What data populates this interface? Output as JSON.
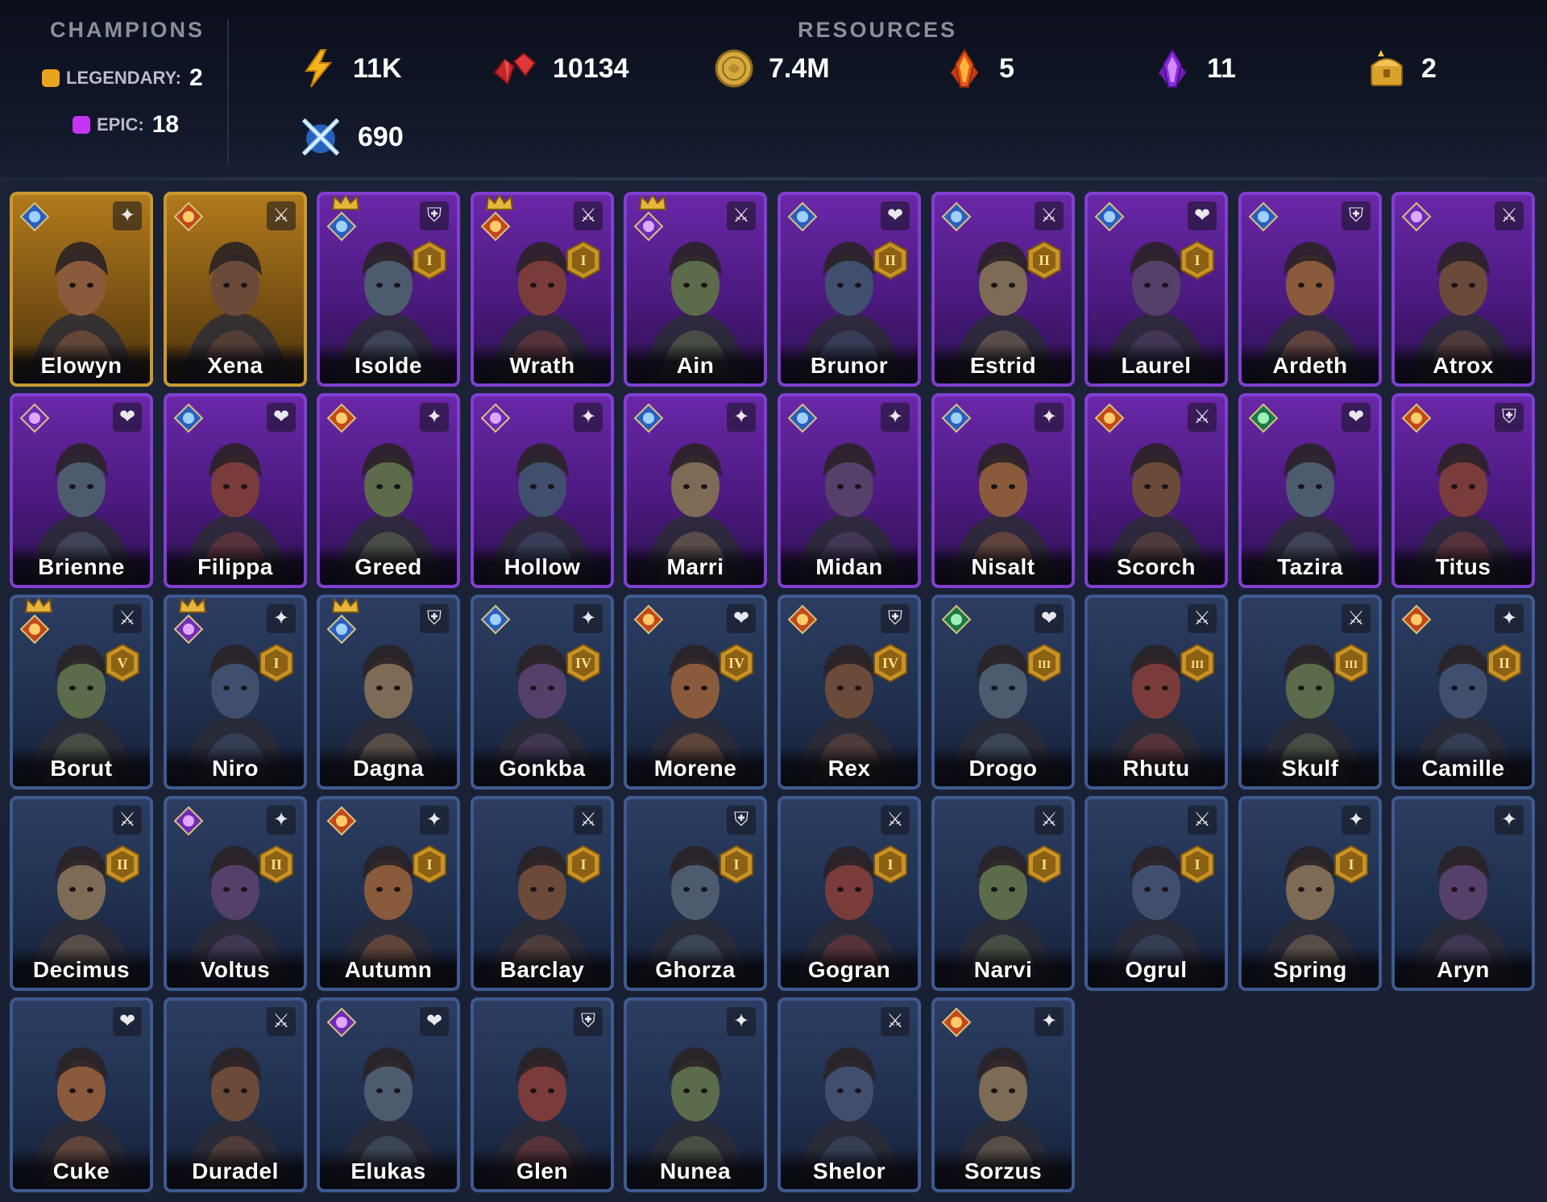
{
  "header": {
    "champions_label": "CHAMPIONS",
    "resources_label": "RESOURCES",
    "legendary_label": "LEGENDARY:",
    "legendary_count": "2",
    "epic_label": "EPIC:",
    "epic_count": "18"
  },
  "resources": {
    "energy": "11K",
    "gems": "10134",
    "silver": "7.4M",
    "fire_shards": "5",
    "void_shards": "11",
    "gold_chest": "2",
    "arena": "690"
  },
  "colors": {
    "legendary": "#e8a41f",
    "epic": "#c534f0",
    "rare_border": "#3e5a90"
  },
  "champions": [
    {
      "name": "Elowyn",
      "rarity": "legendary",
      "affinity": "magic",
      "role": "support",
      "rank": ""
    },
    {
      "name": "Xena",
      "rarity": "legendary",
      "affinity": "force",
      "role": "attack",
      "rank": ""
    },
    {
      "name": "Isolde",
      "rarity": "epic",
      "affinity": "magic",
      "role": "defense",
      "rank": "I",
      "crown": true
    },
    {
      "name": "Wrath",
      "rarity": "epic",
      "affinity": "force",
      "role": "attack",
      "rank": "I",
      "crown": true
    },
    {
      "name": "Ain",
      "rarity": "epic",
      "affinity": "void",
      "role": "attack",
      "rank": "",
      "crown": true
    },
    {
      "name": "Brunor",
      "rarity": "epic",
      "affinity": "magic",
      "role": "hp",
      "rank": "II"
    },
    {
      "name": "Estrid",
      "rarity": "epic",
      "affinity": "magic",
      "role": "attack",
      "rank": "II"
    },
    {
      "name": "Laurel",
      "rarity": "epic",
      "affinity": "magic",
      "role": "hp",
      "rank": "I"
    },
    {
      "name": "Ardeth",
      "rarity": "epic",
      "affinity": "magic",
      "role": "defense",
      "rank": ""
    },
    {
      "name": "Atrox",
      "rarity": "epic",
      "affinity": "void",
      "role": "attack",
      "rank": ""
    },
    {
      "name": "Brienne",
      "rarity": "epic",
      "affinity": "void",
      "role": "hp",
      "rank": ""
    },
    {
      "name": "Filippa",
      "rarity": "epic",
      "affinity": "magic",
      "role": "hp",
      "rank": ""
    },
    {
      "name": "Greed",
      "rarity": "epic",
      "affinity": "force",
      "role": "support",
      "rank": ""
    },
    {
      "name": "Hollow",
      "rarity": "epic",
      "affinity": "void",
      "role": "support",
      "rank": ""
    },
    {
      "name": "Marri",
      "rarity": "epic",
      "affinity": "magic",
      "role": "support",
      "rank": ""
    },
    {
      "name": "Midan",
      "rarity": "epic",
      "affinity": "magic",
      "role": "support",
      "rank": ""
    },
    {
      "name": "Nisalt",
      "rarity": "epic",
      "affinity": "magic",
      "role": "support",
      "rank": ""
    },
    {
      "name": "Scorch",
      "rarity": "epic",
      "affinity": "force",
      "role": "attack",
      "rank": ""
    },
    {
      "name": "Tazira",
      "rarity": "epic",
      "affinity": "spirit",
      "role": "hp",
      "rank": ""
    },
    {
      "name": "Titus",
      "rarity": "epic",
      "affinity": "force",
      "role": "defense",
      "rank": ""
    },
    {
      "name": "Borut",
      "rarity": "rare",
      "affinity": "force",
      "role": "attack",
      "rank": "V",
      "crown": true
    },
    {
      "name": "Niro",
      "rarity": "rare",
      "affinity": "void",
      "role": "support",
      "rank": "I",
      "crown": true
    },
    {
      "name": "Dagna",
      "rarity": "rare",
      "affinity": "magic",
      "role": "defense",
      "rank": "",
      "crown": true
    },
    {
      "name": "Gonkba",
      "rarity": "rare",
      "affinity": "magic",
      "role": "support",
      "rank": "IV"
    },
    {
      "name": "Morene",
      "rarity": "rare",
      "affinity": "force",
      "role": "hp",
      "rank": "IV"
    },
    {
      "name": "Rex",
      "rarity": "rare",
      "affinity": "force",
      "role": "defense",
      "rank": "IV"
    },
    {
      "name": "Drogo",
      "rarity": "rare",
      "affinity": "spirit",
      "role": "hp",
      "rank": "III"
    },
    {
      "name": "Rhutu",
      "rarity": "rare",
      "affinity": "",
      "role": "attack",
      "rank": "III"
    },
    {
      "name": "Skulf",
      "rarity": "rare",
      "affinity": "",
      "role": "attack",
      "rank": "III"
    },
    {
      "name": "Camille",
      "rarity": "rare",
      "affinity": "force",
      "role": "support",
      "rank": "II"
    },
    {
      "name": "Decimus",
      "rarity": "rare",
      "affinity": "",
      "role": "attack",
      "rank": "II"
    },
    {
      "name": "Voltus",
      "rarity": "rare",
      "affinity": "void",
      "role": "support",
      "rank": "II"
    },
    {
      "name": "Autumn",
      "rarity": "rare",
      "affinity": "force",
      "role": "support",
      "rank": "I"
    },
    {
      "name": "Barclay",
      "rarity": "rare",
      "affinity": "",
      "role": "attack",
      "rank": "I"
    },
    {
      "name": "Ghorza",
      "rarity": "rare",
      "affinity": "",
      "role": "defense",
      "rank": "I"
    },
    {
      "name": "Gogran",
      "rarity": "rare",
      "affinity": "",
      "role": "attack",
      "rank": "I"
    },
    {
      "name": "Narvi",
      "rarity": "rare",
      "affinity": "",
      "role": "attack",
      "rank": "I"
    },
    {
      "name": "Ogrul",
      "rarity": "rare",
      "affinity": "",
      "role": "attack",
      "rank": "I"
    },
    {
      "name": "Spring",
      "rarity": "rare",
      "affinity": "",
      "role": "support",
      "rank": "I"
    },
    {
      "name": "Aryn",
      "rarity": "rare",
      "affinity": "",
      "role": "support",
      "rank": ""
    },
    {
      "name": "Cuke",
      "rarity": "rare",
      "affinity": "",
      "role": "hp",
      "rank": ""
    },
    {
      "name": "Duradel",
      "rarity": "rare",
      "affinity": "",
      "role": "attack",
      "rank": ""
    },
    {
      "name": "Elukas",
      "rarity": "rare",
      "affinity": "void",
      "role": "hp",
      "rank": ""
    },
    {
      "name": "Glen",
      "rarity": "rare",
      "affinity": "",
      "role": "defense",
      "rank": ""
    },
    {
      "name": "Nunea",
      "rarity": "rare",
      "affinity": "",
      "role": "support",
      "rank": ""
    },
    {
      "name": "Shelor",
      "rarity": "rare",
      "affinity": "",
      "role": "attack",
      "rank": ""
    },
    {
      "name": "Sorzus",
      "rarity": "rare",
      "affinity": "force",
      "role": "support",
      "rank": ""
    }
  ]
}
